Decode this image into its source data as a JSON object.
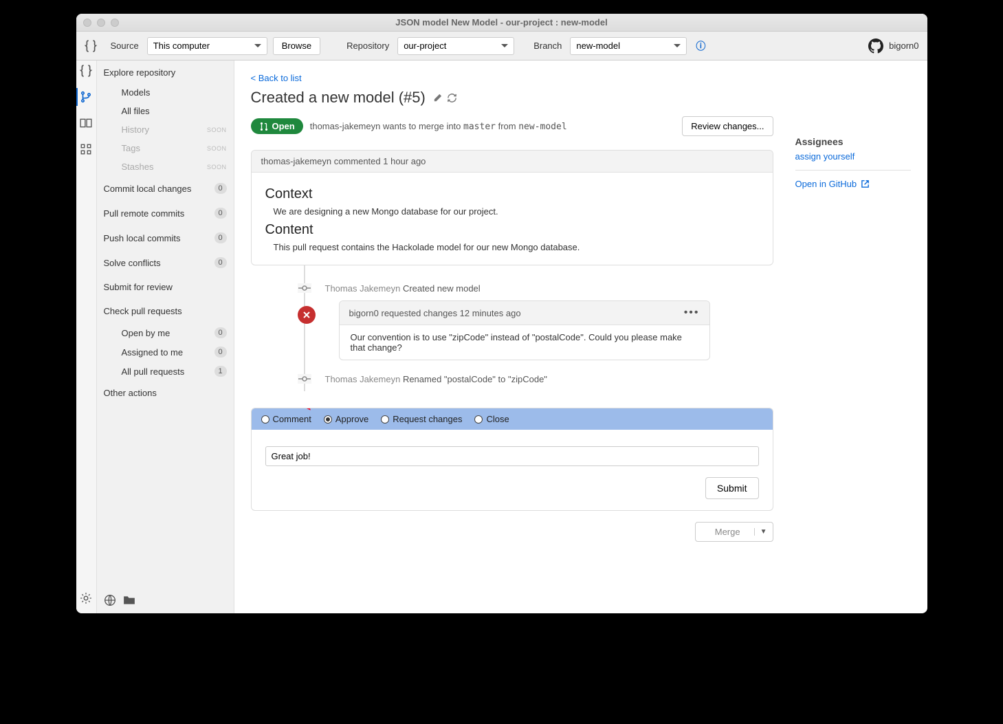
{
  "window": {
    "title": "JSON model New Model - our-project : new-model"
  },
  "toolbar": {
    "source_label": "Source",
    "source_value": "This computer",
    "browse_label": "Browse",
    "repo_label": "Repository",
    "repo_value": "our-project",
    "branch_label": "Branch",
    "branch_value": "new-model",
    "username": "bigorn0"
  },
  "sidebar": {
    "explore": "Explore repository",
    "models": "Models",
    "all_files": "All files",
    "history": "History",
    "tags": "Tags",
    "stashes": "Stashes",
    "soon": "SOON",
    "commit_local": "Commit local changes",
    "pull_remote": "Pull remote commits",
    "push_local": "Push local commits",
    "solve_conflicts": "Solve conflicts",
    "submit_review": "Submit for review",
    "check_pr": "Check pull requests",
    "open_by_me": "Open by me",
    "assigned_to_me": "Assigned to me",
    "all_pr": "All pull requests",
    "other_actions": "Other actions",
    "badges": {
      "commit_local": "0",
      "pull_remote": "0",
      "push_local": "0",
      "solve_conflicts": "0",
      "open_by_me": "0",
      "assigned_to_me": "0",
      "all_pr": "1"
    }
  },
  "pr": {
    "back": "< Back to list",
    "title": "Created a new model (#5)",
    "status": "Open",
    "merge_text_author": "thomas-jakemeyn",
    "merge_text_mid": " wants to merge into ",
    "merge_target": "master",
    "merge_from_label": " from ",
    "merge_source": "new-model",
    "review_changes": "Review changes..."
  },
  "timeline": {
    "first_comment": {
      "header": "thomas-jakemeyn commented 1 hour ago",
      "h1": "Context",
      "p1": "We are designing a new Mongo database for our project.",
      "h2": "Content",
      "p2": "This pull request contains the Hackolade model for our new Mongo database."
    },
    "commit1": {
      "author": "Thomas Jakemeyn",
      "msg": " Created new model"
    },
    "review1": {
      "header_user": "bigorn0",
      "header_action": " requested changes 12 minutes ago",
      "body": "Our convention is to use \"zipCode\" instead of \"postalCode\". Could you please make that change?"
    },
    "commit2": {
      "author": "Thomas Jakemeyn",
      "msg": " Renamed \"postalCode\" to \"zipCode\""
    }
  },
  "action": {
    "comment": "Comment",
    "approve": "Approve",
    "request_changes": "Request changes",
    "close": "Close",
    "input_value": "Great job!",
    "submit": "Submit",
    "merge": "Merge"
  },
  "rightcol": {
    "assignees": "Assignees",
    "assign_yourself": "assign yourself",
    "open_github": "Open in GitHub"
  }
}
